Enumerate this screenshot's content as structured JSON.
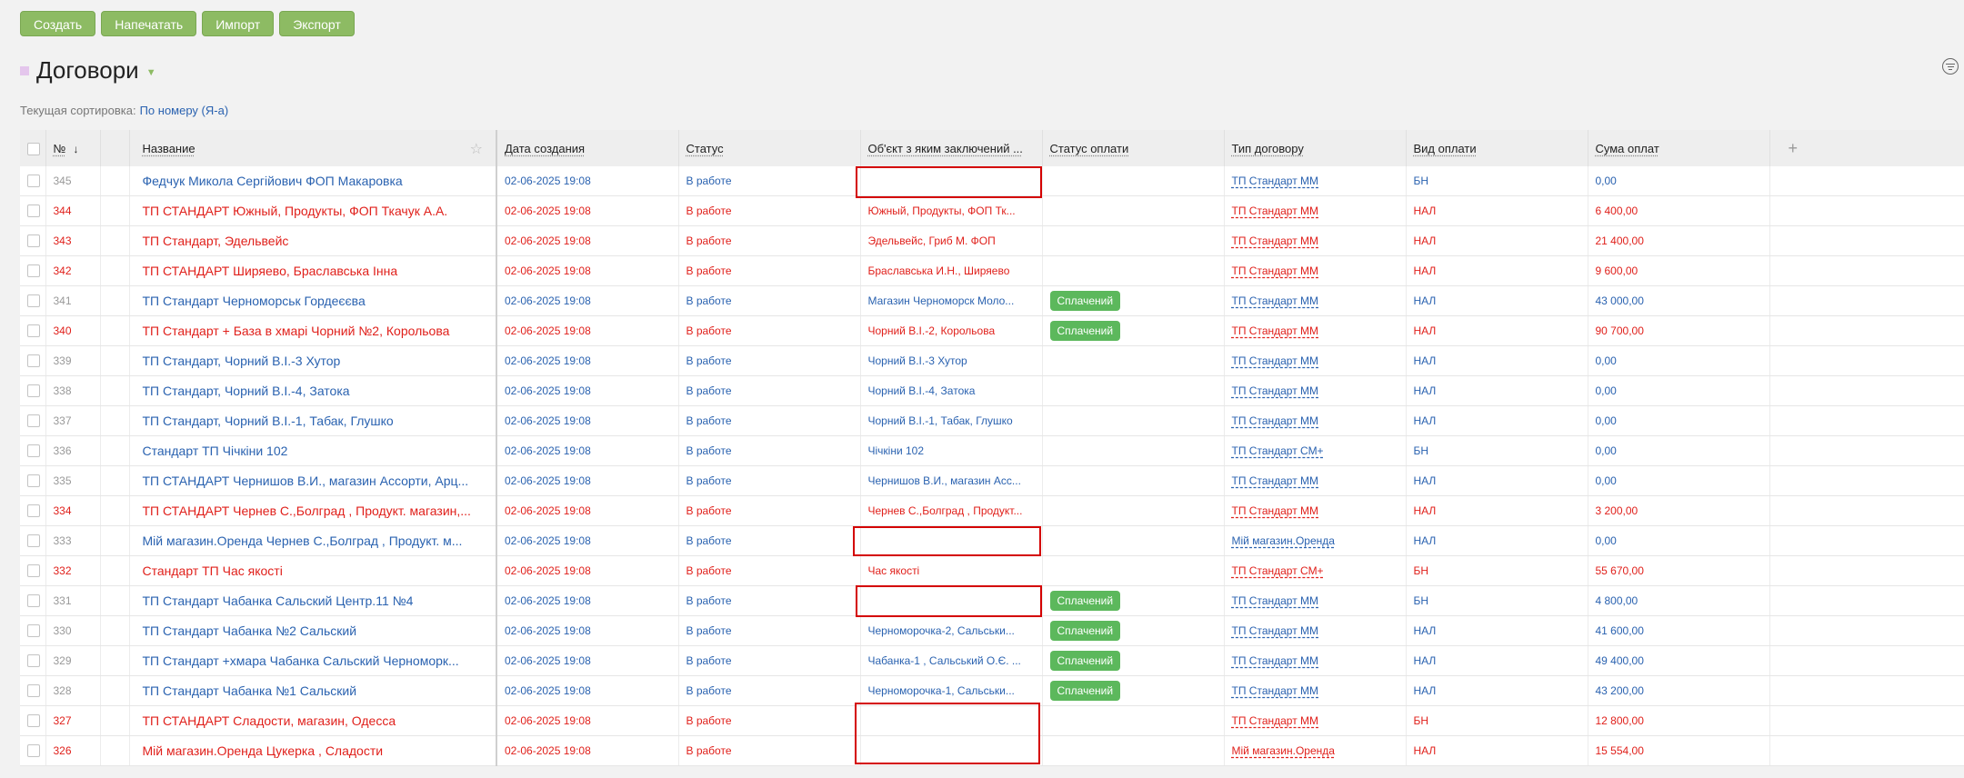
{
  "toolbar": {
    "create": "Создать",
    "print": "Напечатать",
    "import": "Импорт",
    "export": "Экспорт"
  },
  "page": {
    "title": "Договори",
    "sort_label": "Текущая сортировка:",
    "sort_value": "По номеру (Я-а)"
  },
  "columns": {
    "num": "№",
    "name": "Название",
    "created": "Дата создания",
    "status": "Статус",
    "object": "Об'єкт з яким заключений ...",
    "payment_status": "Статус оплати",
    "contract_type": "Тип договору",
    "payment_kind": "Вид оплати",
    "payment_sum": "Сума оплат"
  },
  "colors": {
    "button_green": "#8dbb63",
    "link_blue": "#2a62b0",
    "alert_red": "#e0201b",
    "badge_green": "#5cb85c"
  },
  "rows": [
    {
      "num": "345",
      "name": "Федчук Микола Сергійович ФОП Макаровка",
      "created": "02-06-2025 19:08",
      "status": "В работе",
      "object": "",
      "payment_status": "",
      "contract_type": "ТП Стандарт ММ",
      "payment_kind": "БН",
      "payment_sum": "0,00",
      "tone": "blue"
    },
    {
      "num": "344",
      "name": "ТП СТАНДАРТ Южный, Продукты, ФОП Ткачук А.А.",
      "created": "02-06-2025 19:08",
      "status": "В работе",
      "object": "Южный, Продукты, ФОП Тк...",
      "payment_status": "",
      "contract_type": "ТП Стандарт ММ",
      "payment_kind": "НАЛ",
      "payment_sum": "6 400,00",
      "tone": "red"
    },
    {
      "num": "343",
      "name": "ТП Стандарт, Эдельвейс",
      "created": "02-06-2025 19:08",
      "status": "В работе",
      "object": "Эдельвейс, Гриб М. ФОП",
      "payment_status": "",
      "contract_type": "ТП Стандарт ММ",
      "payment_kind": "НАЛ",
      "payment_sum": "21 400,00",
      "tone": "red"
    },
    {
      "num": "342",
      "name": "ТП СТАНДАРТ Ширяево, Браславська Інна",
      "created": "02-06-2025 19:08",
      "status": "В работе",
      "object": "Браславська И.Н., Ширяево",
      "payment_status": "",
      "contract_type": "ТП Стандарт ММ",
      "payment_kind": "НАЛ",
      "payment_sum": "9 600,00",
      "tone": "red"
    },
    {
      "num": "341",
      "name": "ТП Стандарт Черноморськ Гордеєєва",
      "created": "02-06-2025 19:08",
      "status": "В работе",
      "object": "Магазин Черноморск Моло...",
      "payment_status": "Сплачений",
      "contract_type": "ТП Стандарт ММ",
      "payment_kind": "НАЛ",
      "payment_sum": "43 000,00",
      "tone": "blue"
    },
    {
      "num": "340",
      "name": "ТП Стандарт + База в хмарі Чорний №2, Корольова",
      "created": "02-06-2025 19:08",
      "status": "В работе",
      "object": "Чорний В.І.-2, Корольова",
      "payment_status": "Сплачений",
      "contract_type": "ТП Стандарт ММ",
      "payment_kind": "НАЛ",
      "payment_sum": "90 700,00",
      "tone": "red"
    },
    {
      "num": "339",
      "name": "ТП Стандарт, Чорний В.І.-3 Хутор",
      "created": "02-06-2025 19:08",
      "status": "В работе",
      "object": "Чорний В.І.-3 Хутор",
      "payment_status": "",
      "contract_type": "ТП Стандарт ММ",
      "payment_kind": "НАЛ",
      "payment_sum": "0,00",
      "tone": "blue"
    },
    {
      "num": "338",
      "name": "ТП Стандарт, Чорний В.І.-4, Затока",
      "created": "02-06-2025 19:08",
      "status": "В работе",
      "object": "Чорний В.І.-4, Затока",
      "payment_status": "",
      "contract_type": "ТП Стандарт ММ",
      "payment_kind": "НАЛ",
      "payment_sum": "0,00",
      "tone": "blue"
    },
    {
      "num": "337",
      "name": "ТП Стандарт, Чорний В.І.-1, Табак, Глушко",
      "created": "02-06-2025 19:08",
      "status": "В работе",
      "object": "Чорний В.І.-1, Табак, Глушко",
      "payment_status": "",
      "contract_type": "ТП Стандарт ММ",
      "payment_kind": "НАЛ",
      "payment_sum": "0,00",
      "tone": "blue"
    },
    {
      "num": "336",
      "name": "Стандарт ТП Чічкіни 102",
      "created": "02-06-2025 19:08",
      "status": "В работе",
      "object": "Чічкіни 102",
      "payment_status": "",
      "contract_type": "ТП Стандарт СМ+",
      "payment_kind": "БН",
      "payment_sum": "0,00",
      "tone": "blue"
    },
    {
      "num": "335",
      "name": "ТП СТАНДАРТ Чернишов В.И., магазин Ассорти, Арц...",
      "created": "02-06-2025 19:08",
      "status": "В работе",
      "object": "Чернишов В.И., магазин Асс...",
      "payment_status": "",
      "contract_type": "ТП Стандарт ММ",
      "payment_kind": "НАЛ",
      "payment_sum": "0,00",
      "tone": "blue"
    },
    {
      "num": "334",
      "name": "ТП СТАНДАРТ Чернев С.,Болград , Продукт. магазин,...",
      "created": "02-06-2025 19:08",
      "status": "В работе",
      "object": "Чернев С.,Болград , Продукт...",
      "payment_status": "",
      "contract_type": "ТП Стандарт ММ",
      "payment_kind": "НАЛ",
      "payment_sum": "3 200,00",
      "tone": "red"
    },
    {
      "num": "333",
      "name": "Мій магазин.Оренда Чернев С.,Болград , Продукт. м...",
      "created": "02-06-2025 19:08",
      "status": "В работе",
      "object": "",
      "payment_status": "",
      "contract_type": "Мій магазин.Оренда",
      "payment_kind": "НАЛ",
      "payment_sum": "0,00",
      "tone": "blue"
    },
    {
      "num": "332",
      "name": "Стандарт ТП Час якості",
      "created": "02-06-2025 19:08",
      "status": "В работе",
      "object": "Час якості",
      "payment_status": "",
      "contract_type": "ТП Стандарт СМ+",
      "payment_kind": "БН",
      "payment_sum": "55 670,00",
      "tone": "red"
    },
    {
      "num": "331",
      "name": "ТП Стандарт Чабанка Сальский Центр.11 №4",
      "created": "02-06-2025 19:08",
      "status": "В работе",
      "object": "",
      "payment_status": "Сплачений",
      "contract_type": "ТП Стандарт ММ",
      "payment_kind": "БН",
      "payment_sum": "4 800,00",
      "tone": "blue"
    },
    {
      "num": "330",
      "name": "ТП Стандарт Чабанка №2 Сальский",
      "created": "02-06-2025 19:08",
      "status": "В работе",
      "object": "Черноморочка-2, Сальськи...",
      "payment_status": "Сплачений",
      "contract_type": "ТП Стандарт ММ",
      "payment_kind": "НАЛ",
      "payment_sum": "41 600,00",
      "tone": "blue"
    },
    {
      "num": "329",
      "name": "ТП Стандарт +хмара Чабанка Сальский Черноморк...",
      "created": "02-06-2025 19:08",
      "status": "В работе",
      "object": "Чабанка-1 , Сальський О.Є. ...",
      "payment_status": "Сплачений",
      "contract_type": "ТП Стандарт ММ",
      "payment_kind": "НАЛ",
      "payment_sum": "49 400,00",
      "tone": "blue"
    },
    {
      "num": "328",
      "name": "ТП Стандарт Чабанка №1 Сальский",
      "created": "02-06-2025 19:08",
      "status": "В работе",
      "object": "Черноморочка-1, Сальськи...",
      "payment_status": "Сплачений",
      "contract_type": "ТП Стандарт ММ",
      "payment_kind": "НАЛ",
      "payment_sum": "43 200,00",
      "tone": "blue"
    },
    {
      "num": "327",
      "name": "ТП СТАНДАРТ Сладости, магазин, Одесса",
      "created": "02-06-2025 19:08",
      "status": "В работе",
      "object": "",
      "payment_status": "",
      "contract_type": "ТП Стандарт ММ",
      "payment_kind": "БН",
      "payment_sum": "12 800,00",
      "tone": "red"
    },
    {
      "num": "326",
      "name": "Мій магазин.Оренда Цукерка , Сладости",
      "created": "02-06-2025 19:08",
      "status": "В работе",
      "object": "",
      "payment_status": "",
      "contract_type": "Мій магазин.Оренда",
      "payment_kind": "НАЛ",
      "payment_sum": "15 554,00",
      "tone": "red"
    }
  ]
}
